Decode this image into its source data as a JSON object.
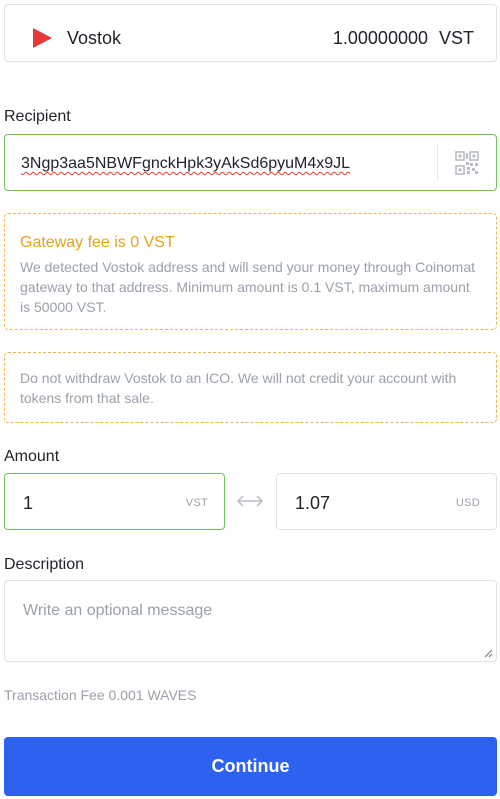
{
  "asset": {
    "name": "Vostok",
    "balance": "1.00000000",
    "ticker": "VST",
    "icon": "play-triangle-icon",
    "icon_color": "#e53935"
  },
  "recipient": {
    "label": "Recipient",
    "value": "3Ngp3aa5NBWFgnckHpk3yAkSd6pyuM4x9JL",
    "qr_icon": "qr-code-icon"
  },
  "gateway_notice": {
    "title": "Gateway fee is 0 VST",
    "text": "We detected Vostok address and will send your money through Coinomat gateway to that address. Minimum amount is 0.1 VST, maximum amount is 50000 VST."
  },
  "ico_notice": {
    "text": "Do not withdraw Vostok to an ICO. We will not credit your account with tokens from that sale."
  },
  "amount": {
    "label": "Amount",
    "value": "1",
    "unit": "VST",
    "converted_value": "1.07",
    "converted_unit": "USD"
  },
  "description": {
    "label": "Description",
    "placeholder": "Write an optional message"
  },
  "fee": {
    "text": "Transaction Fee 0.001 WAVES"
  },
  "continue_label": "Continue",
  "colors": {
    "accent": "#2d62f0",
    "valid_border": "#6fc45a",
    "warning": "#e8a317"
  }
}
